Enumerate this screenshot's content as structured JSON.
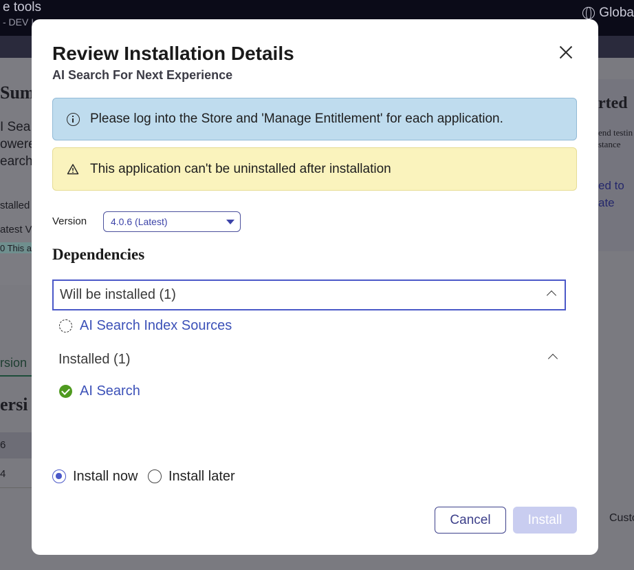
{
  "background": {
    "app_title": "e tools",
    "app_subtitle": "- DEV I",
    "language_label": "Globa",
    "heading_fragment": "Sum",
    "desc_lines": [
      "I Sea",
      "owere",
      "earch"
    ],
    "installed_fragment": "stalled",
    "latest_fragment": "atest V",
    "badge_fragment": "0 This a",
    "side_heading_fragment": "rted",
    "side_lines": [
      "end testin",
      "stance"
    ],
    "side_link_lines": [
      "ed to",
      "ate"
    ],
    "tab_fragment": "rsion",
    "section_fragment": "ersi",
    "row_values": [
      "6",
      "4"
    ],
    "right_fragment": "Custo"
  },
  "modal": {
    "title": "Review Installation Details",
    "subtitle": "AI Search For Next Experience",
    "info_message": "Please log into the Store and 'Manage Entitlement' for each application.",
    "warning_message": "This application can't be uninstalled after installation",
    "version_label": "Version",
    "version_value": "4.0.6 (Latest)",
    "dependencies_heading": "Dependencies",
    "will_install_header": "Will be installed (1)",
    "will_install_items": [
      "AI Search Index Sources"
    ],
    "installed_header": "Installed (1)",
    "installed_items": [
      "AI Search"
    ],
    "install_now_label": "Install now",
    "install_later_label": "Install later",
    "selected_option": "Install now",
    "cancel_label": "Cancel",
    "install_label": "Install"
  }
}
